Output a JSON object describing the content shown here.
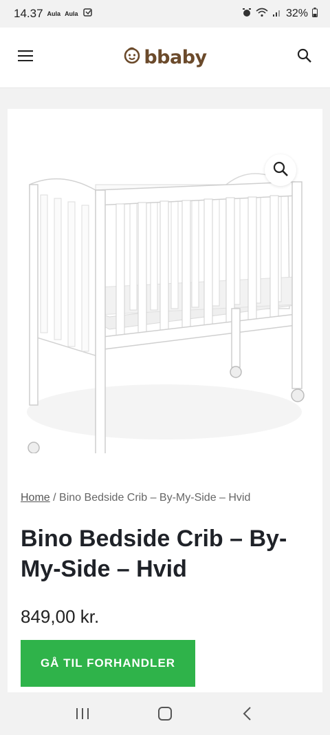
{
  "status_bar": {
    "time": "14.37",
    "notif1": "Aula",
    "notif2": "Aula",
    "battery": "32%"
  },
  "header": {
    "logo_text": "bbaby",
    "menu_icon": "hamburger-menu-icon",
    "search_icon": "search-icon"
  },
  "product": {
    "image_alt": "Bino Bedside Crib – By-My-Side – Hvid",
    "breadcrumb_home": "Home",
    "breadcrumb_separator": "/",
    "breadcrumb_current": "Bino Bedside Crib – By-My-Side – Hvid",
    "title": "Bino Bedside Crib – By-My-Side – Hvid",
    "price": "849,00 kr.",
    "cta_label": "GÅ TIL FORHANDLER",
    "cta_color": "#2fb34a"
  },
  "nav": {
    "recent_icon": "recent-apps-icon",
    "home_icon": "home-icon",
    "back_icon": "back-icon"
  }
}
